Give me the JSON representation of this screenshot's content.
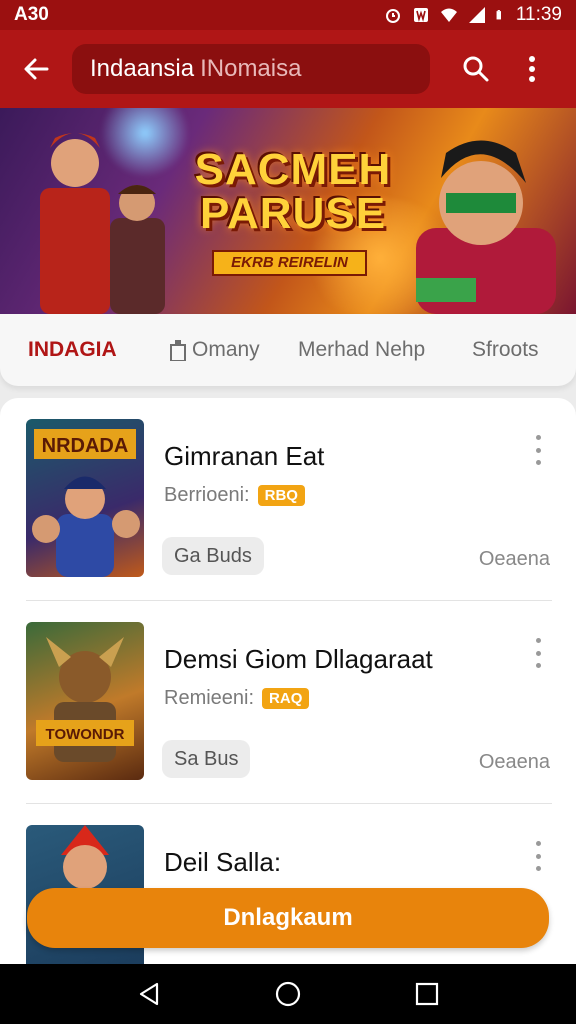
{
  "status_bar": {
    "left_text": "A30",
    "time": "11:39",
    "icons": [
      "alarm-icon",
      "notification-icon",
      "wifi-icon",
      "signal-icon",
      "battery-icon"
    ]
  },
  "app_bar": {
    "search_text": "Indaansia",
    "search_subtext": "INomaisa",
    "icons": [
      "back-arrow-icon",
      "search-icon",
      "more-vert-icon"
    ]
  },
  "banner": {
    "title_line1": "SACMEH",
    "title_line2": "PARUSE",
    "ribbon_text": "EKRB REIRELIN"
  },
  "tabs": [
    {
      "label": "INDAGIA",
      "active": true
    },
    {
      "label": "Omany",
      "active": false,
      "icon": "building-icon"
    },
    {
      "label": "Merhad Nehp",
      "active": false
    },
    {
      "label": "Sfroots",
      "active": false
    }
  ],
  "items": [
    {
      "title": "Gimranan Eat",
      "subtitle": "Berrioeni:",
      "badge": "RBQ",
      "chip": "Ga Buds",
      "right_label": "Oeaena",
      "thumb_title": "NRDADA"
    },
    {
      "title": "Demsi Giom Dllagaraat",
      "subtitle": "Remieeni:",
      "badge": "RAQ",
      "chip": "Sa Bus",
      "right_label": "Oeaena",
      "thumb_title": "TOWONDR"
    },
    {
      "title": "Deil Salla:",
      "subtitle": "",
      "badge": "",
      "chip": "",
      "right_label": ""
    }
  ],
  "cta": {
    "label": "Dnlagkaum"
  },
  "colors": {
    "primary": "#b01616",
    "primary_dark": "#8b0f0f",
    "accent": "#e8840c",
    "badge": "#f2a413"
  }
}
